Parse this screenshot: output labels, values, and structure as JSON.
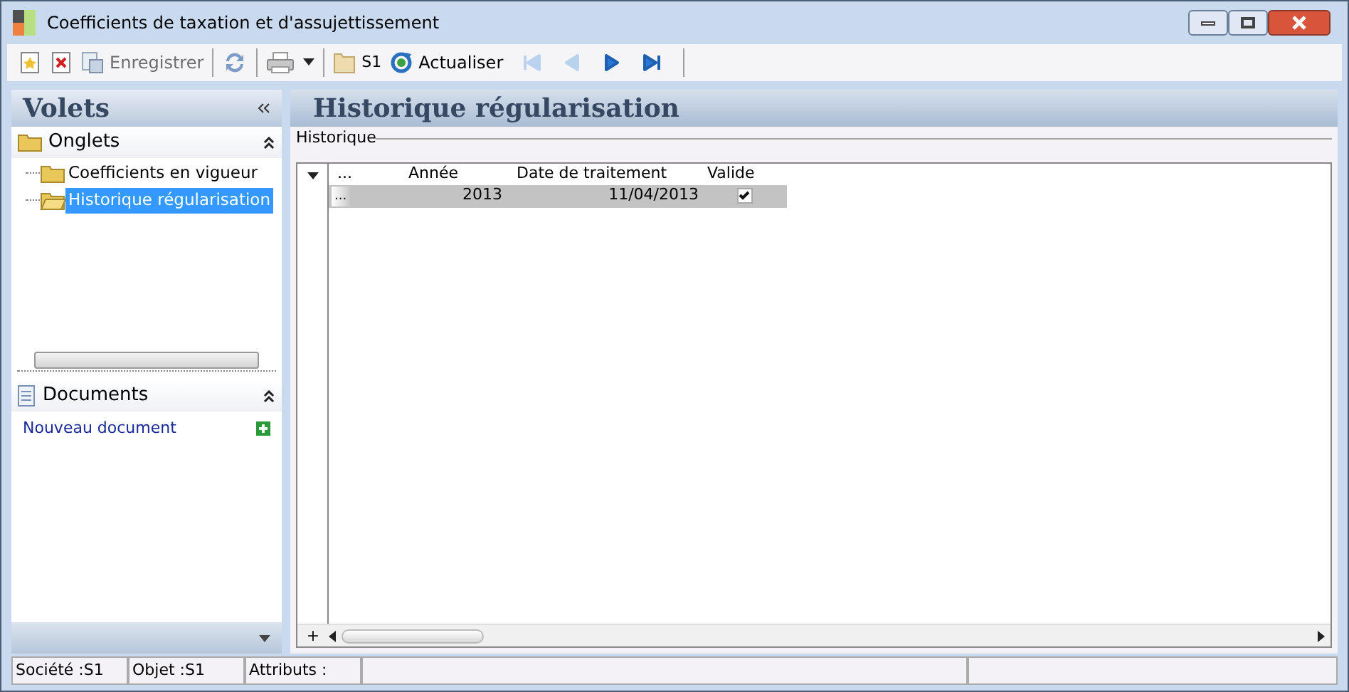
{
  "window": {
    "title": "Coefficients de taxation et d'assujettissement"
  },
  "toolbar": {
    "save": {
      "label": "Enregistrer",
      "disabled": true
    },
    "company": {
      "label": "S1"
    },
    "refresh": {
      "label": "Actualiser"
    },
    "navigation": [
      {
        "disabled": true
      },
      {
        "disabled": true
      },
      {
        "disabled": false
      },
      {
        "disabled": false
      }
    ]
  },
  "sidebar": {
    "title": "Volets",
    "sections": [
      {
        "title": "Onglets",
        "expanded": true,
        "items": [
          {
            "label": "Coefficients en vigueur",
            "selected": false
          },
          {
            "label": "Historique régularisation",
            "selected": true
          }
        ]
      },
      {
        "title": "Documents",
        "expanded": true,
        "links": [
          "Nouveau document"
        ]
      }
    ]
  },
  "main": {
    "title": "Historique régularisation",
    "group": "Historique",
    "table": {
      "columns": [
        "...",
        "Année",
        "Date de traitement",
        "Valide"
      ],
      "rows": [
        {
          "marker": "...",
          "year": "2013",
          "date": "11/04/2013",
          "valid": true,
          "selected": true
        }
      ],
      "add_row": "+"
    }
  },
  "status_bar": [
    "Société :S1",
    "Objet :S1",
    "Attributs :"
  ]
}
